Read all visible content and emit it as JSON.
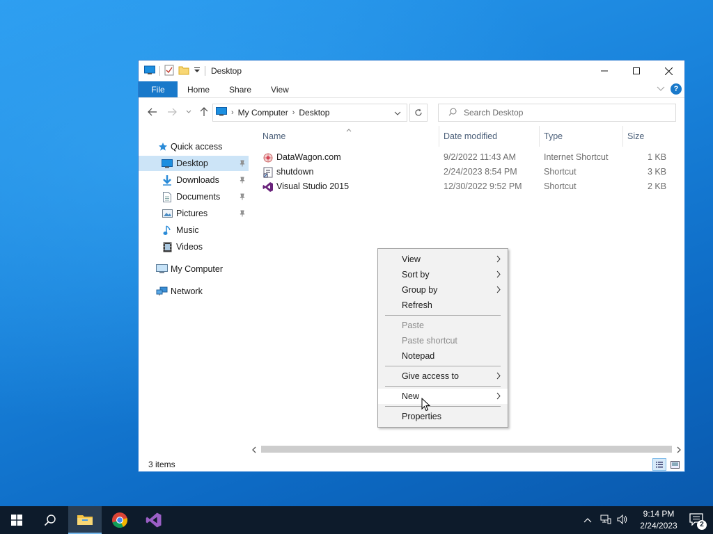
{
  "window": {
    "title": "Desktop",
    "ribbon_tabs": [
      "File",
      "Home",
      "Share",
      "View"
    ],
    "help_label": "?"
  },
  "address": {
    "segments": [
      "My Computer",
      "Desktop"
    ],
    "search_placeholder": "Search Desktop"
  },
  "navpane": {
    "items": [
      {
        "label": "Quick access",
        "icon": "star-icon"
      },
      {
        "label": "Desktop",
        "icon": "desktop-icon"
      },
      {
        "label": "Downloads",
        "icon": "download-icon"
      },
      {
        "label": "Documents",
        "icon": "documents-icon"
      },
      {
        "label": "Pictures",
        "icon": "pictures-icon"
      },
      {
        "label": "Music",
        "icon": "music-icon"
      },
      {
        "label": "Videos",
        "icon": "videos-icon"
      },
      {
        "label": "My Computer",
        "icon": "computer-icon"
      },
      {
        "label": "Network",
        "icon": "network-icon"
      }
    ]
  },
  "files": {
    "columns": [
      "Name",
      "Date modified",
      "Type",
      "Size"
    ],
    "rows": [
      {
        "name": "DataWagon.com",
        "date": "9/2/2022 11:43 AM",
        "type": "Internet Shortcut",
        "size": "1 KB",
        "icon": "internet-shortcut-icon"
      },
      {
        "name": "shutdown",
        "date": "2/24/2023 8:54 PM",
        "type": "Shortcut",
        "size": "3 KB",
        "icon": "shortcut-icon"
      },
      {
        "name": "Visual Studio 2015",
        "date": "12/30/2022 9:52 PM",
        "type": "Shortcut",
        "size": "2 KB",
        "icon": "visual-studio-icon"
      }
    ]
  },
  "status": {
    "items_count": "3 items"
  },
  "context_menu": {
    "items": [
      {
        "label": "View",
        "submenu": true
      },
      {
        "label": "Sort by",
        "submenu": true
      },
      {
        "label": "Group by",
        "submenu": true
      },
      {
        "label": "Refresh"
      },
      {
        "label": "Paste",
        "disabled": true
      },
      {
        "label": "Paste shortcut",
        "disabled": true
      },
      {
        "label": "Notepad"
      },
      {
        "label": "Give access to",
        "submenu": true
      },
      {
        "label": "New",
        "submenu": true,
        "hovered": true
      },
      {
        "label": "Properties"
      }
    ]
  },
  "taskbar": {
    "time": "9:14 PM",
    "date": "2/24/2023",
    "notification_count": "2"
  },
  "colors": {
    "accent": "#1979ca",
    "selection": "#cce4f7",
    "taskbar": "#0d1b2b"
  }
}
